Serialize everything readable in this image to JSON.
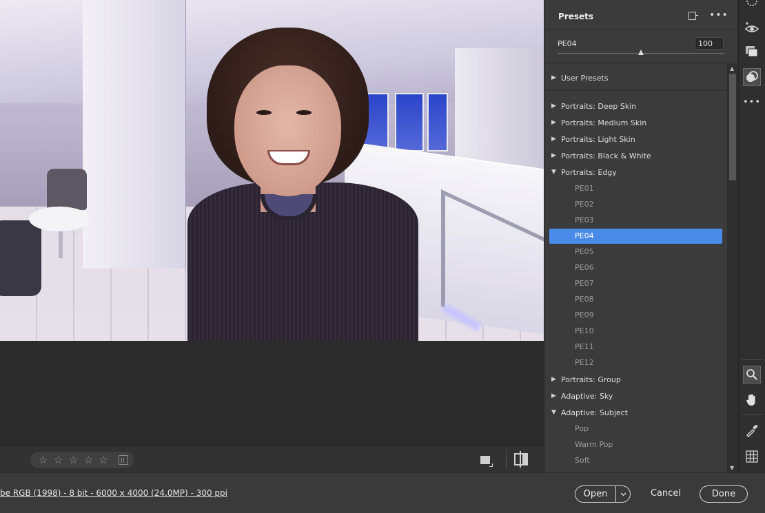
{
  "photo": {
    "alt": ""
  },
  "image_bar": {
    "rating_stars": [
      "☆",
      "☆",
      "☆",
      "☆",
      "☆"
    ]
  },
  "footer": {
    "workflow_text": "be RGB (1998) - 8 bit - 6000 x 4000 (24.0MP) - 300 ppi",
    "open_label": "Open",
    "cancel_label": "Cancel",
    "done_label": "Done"
  },
  "panel": {
    "title": "Presets",
    "amount": {
      "label": "PE04",
      "value": "100",
      "fraction": 0.5
    },
    "groups": [
      {
        "label": "User Presets",
        "expanded": false
      },
      {
        "label": "Portraits: Deep Skin",
        "expanded": false
      },
      {
        "label": "Portraits: Medium Skin",
        "expanded": false
      },
      {
        "label": "Portraits: Light Skin",
        "expanded": false
      },
      {
        "label": "Portraits: Black & White",
        "expanded": false
      },
      {
        "label": "Portraits: Edgy",
        "expanded": true,
        "items": [
          "PE01",
          "PE02",
          "PE03",
          "PE04",
          "PE05",
          "PE06",
          "PE07",
          "PE08",
          "PE09",
          "PE10",
          "PE11",
          "PE12"
        ],
        "selected": "PE04"
      },
      {
        "label": "Portraits: Group",
        "expanded": false
      },
      {
        "label": "Adaptive: Sky",
        "expanded": false
      },
      {
        "label": "Adaptive: Subject",
        "expanded": true,
        "items": [
          "Pop",
          "Warm Pop",
          "Soft"
        ]
      }
    ]
  },
  "tools": [
    "edit-icon",
    "red-eye-icon",
    "snapshots-icon",
    "presets-icon",
    "more-icon",
    "zoom-icon",
    "hand-icon",
    "color-sampler-icon",
    "grid-icon"
  ],
  "colors": {
    "accent": "#4a8ae8",
    "panel": "#3b3b3b",
    "background": "#2b2b2b"
  }
}
